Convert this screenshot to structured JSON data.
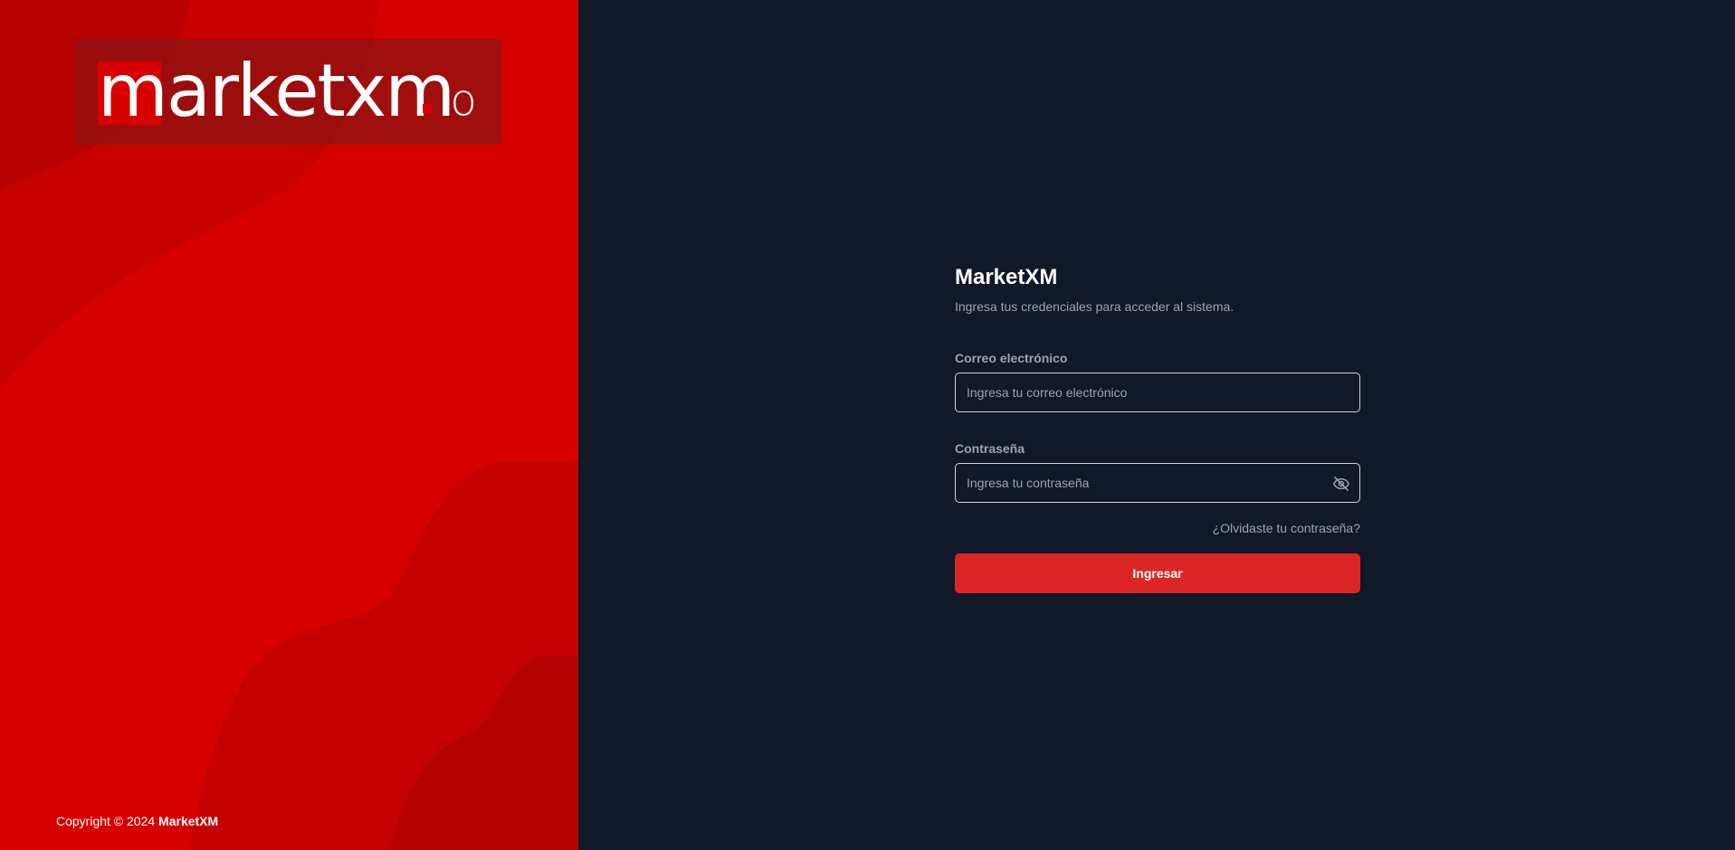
{
  "brand": {
    "logo_word": "marketxm",
    "logo_suffix": "io",
    "accent": "#d70000"
  },
  "login": {
    "title": "MarketXM",
    "subtitle": "Ingresa tus credenciales para acceder al sistema.",
    "email_label": "Correo electrónico",
    "email_value": "",
    "email_placeholder": "Ingresa tu correo electrónico",
    "password_label": "Contraseña",
    "password_value": "",
    "password_placeholder": "Ingresa tu contraseña",
    "password_toggle_icon": "eye-off-icon",
    "forgot_link": "¿Olvidaste tu contraseña?",
    "submit_label": "Ingresar",
    "submit_color": "#dc2626"
  },
  "footer": {
    "copyright_prefix": "Copyright © 2024",
    "copyright_brand": "MarketXM"
  }
}
